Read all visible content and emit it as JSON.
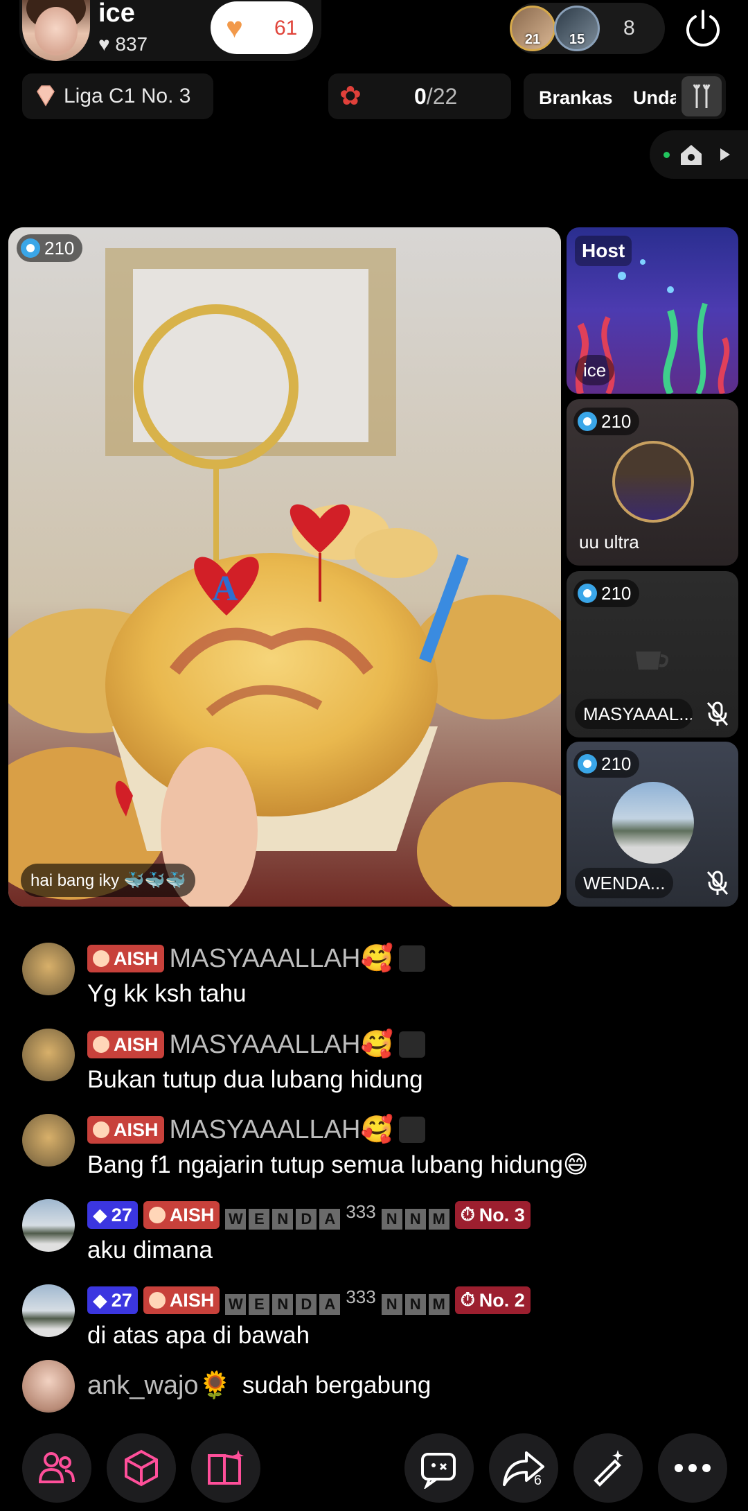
{
  "header": {
    "host_name": "ice",
    "host_likes": "837",
    "follow_count": "61",
    "viewer_ranks": [
      "21",
      "15"
    ],
    "viewer_count": "8"
  },
  "row2": {
    "league_label": "Liga C1 No. 3",
    "goal_current": "0",
    "goal_total": "/22",
    "vault_label": "Brankas",
    "invite_label": "Unda"
  },
  "main_video": {
    "badge": "210",
    "caption": "hai bang iky 🐳🐳🐳"
  },
  "tiles": [
    {
      "label": "Host",
      "name": "ice"
    },
    {
      "badge": "210",
      "name": "uu ultra"
    },
    {
      "badge": "210",
      "name": "MASYAAAL..."
    },
    {
      "badge": "210",
      "name": "WENDA..."
    }
  ],
  "chat": [
    {
      "tag": "AISH",
      "user": "MASYAAALLAH🥰",
      "message": "Yg kk ksh tahu"
    },
    {
      "tag": "AISH",
      "user": "MASYAAALLAH🥰",
      "message": "Bukan tutup dua lubang hidung"
    },
    {
      "tag": "AISH",
      "user": "MASYAAALLAH🥰",
      "message": "Bang f1 ngajarin tutup semua lubang hidung😄"
    },
    {
      "level": "27",
      "tag": "AISH",
      "user_boxes": [
        "W",
        "E",
        "N",
        "D",
        "A"
      ],
      "user_sup": "333",
      "user_boxes2": [
        "N",
        "N",
        "M"
      ],
      "rank": "No. 3",
      "message": "aku dimana"
    },
    {
      "level": "27",
      "tag": "AISH",
      "user_boxes": [
        "W",
        "E",
        "N",
        "D",
        "A"
      ],
      "user_sup": "333",
      "user_boxes2": [
        "N",
        "N",
        "M"
      ],
      "rank": "No. 2",
      "message": "di atas apa di bawah"
    },
    {
      "user": "ank_wajo🌻",
      "message": "sudah bergabung"
    }
  ],
  "bottom_bar": {
    "share_count": "6",
    "icons": [
      "people-icon",
      "cube-icon",
      "book-sparkle-icon",
      "chat-bubble-icon",
      "share-icon",
      "magic-wand-icon",
      "more-icon"
    ]
  },
  "colors": {
    "accent_orange": "#f2994a",
    "tag_red": "#c8413b",
    "level_blue": "#3b36e0",
    "online_green": "#22c55e"
  }
}
